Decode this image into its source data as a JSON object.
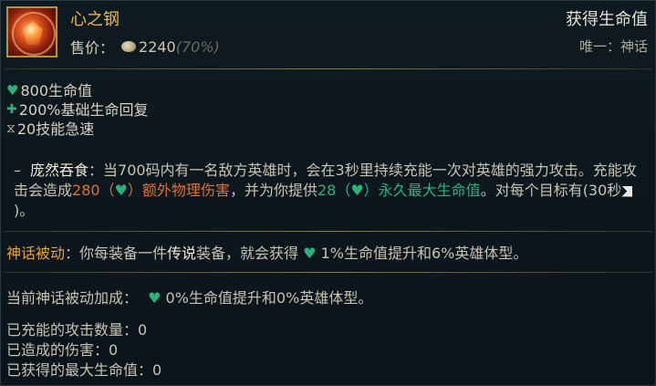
{
  "item": {
    "name": "心之钢",
    "price_label": "售价：",
    "price_value": "2240",
    "price_pct": "(70%)",
    "effect_title": "获得生命值",
    "effect_sub": "唯一：神话"
  },
  "stats": [
    {
      "icon": "heart-icon",
      "text": "800生命值"
    },
    {
      "icon": "health-regen-icon",
      "text": "200%基础生命回复"
    },
    {
      "icon": "ability-haste-icon",
      "text": "20技能急速"
    }
  ],
  "passive": {
    "dash": "–",
    "name": "庞然吞食",
    "text_1": "：当700码内有一名敌方英雄时，会在3秒里持续充能一次对英雄的强力攻击。充能攻击会造成",
    "damage_value": "280",
    "damage_open": "（",
    "damage_text": "）额外物理伤害",
    "text_2": "，并为你提供",
    "hp_value": "28",
    "hp_open": "（",
    "hp_text": "）永久最大生命值",
    "text_3": "。对每个目标有(30秒",
    "text_4": ")。"
  },
  "mythic": {
    "label": "神话被动",
    "text_1": "：你每装备一件",
    "bold": "传说",
    "text_2": "装备，就会获得",
    "text_3": "1%生命值提升和6%英雄体型。"
  },
  "current": {
    "label": "当前神话被动加成：",
    "text": "0%生命值提升和0%英雄体型。"
  },
  "counters": [
    {
      "label": "已充能的攻击数量：",
      "value": "0"
    },
    {
      "label": "已造成的伤害：",
      "value": "0"
    },
    {
      "label": "已获得的最大生命值：",
      "value": "0"
    }
  ],
  "colors": {
    "gold": "#f0b44a",
    "green": "#2fb07a",
    "orange": "#e0703a",
    "mythic": "#e8a23c"
  }
}
